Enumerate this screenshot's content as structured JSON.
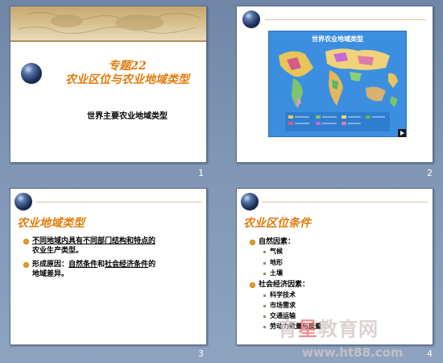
{
  "slides": [
    {
      "number": "1",
      "title_line1": "专题22",
      "title_line2": "农业区位与农业地域类型",
      "subtitle": "世界主要农业地域类型"
    },
    {
      "number": "2",
      "map_title": "世界农业地域类型"
    },
    {
      "number": "3",
      "title": "农业地域类型",
      "bullet1_line1": "不同地域内具有不同部门结构和特点的",
      "bullet1_line2": "农业生产类型。",
      "bullet2_prefix": "形成原因：",
      "bullet2_u1": "自然条件",
      "bullet2_and": "和",
      "bullet2_u2": "社会经济条件",
      "bullet2_suffix": "的",
      "bullet2_line2": "地域差异。"
    },
    {
      "number": "4",
      "title": "农业区位条件",
      "group1": "自然因素：",
      "group1_items": [
        "气候",
        "地形",
        "土壤"
      ],
      "group2": "社会经济因素：",
      "group2_items": [
        "科学技术",
        "市场需求",
        "交通运输",
        "劳动力数量与质量"
      ]
    }
  ],
  "watermark": {
    "line1_a": "育",
    "line1_b": "星",
    "line1_c": "教育网",
    "line2": "www.ht88.com"
  }
}
